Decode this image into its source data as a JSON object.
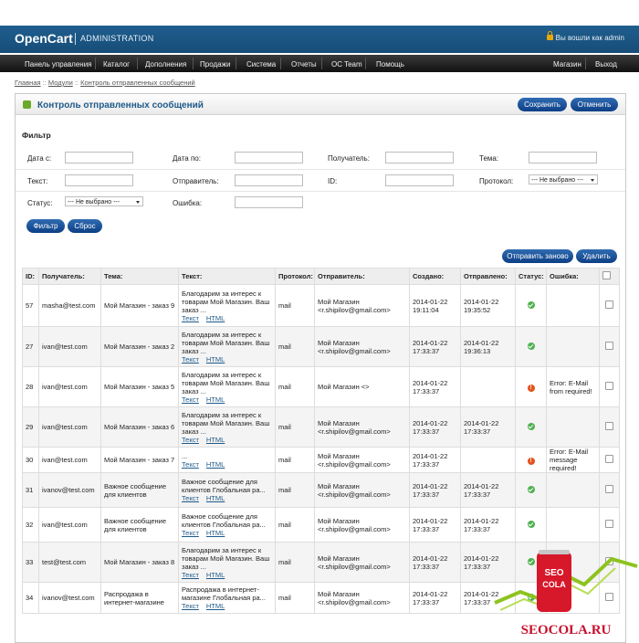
{
  "header": {
    "logo": "OpenCart",
    "subtitle": "ADMINISTRATION",
    "login_text": "Вы вошли как admin"
  },
  "menu": {
    "left": [
      "Панель управления",
      "Каталог",
      "Дополнения",
      "Продажи",
      "Система",
      "Отчеты",
      "OC Team",
      "Помощь"
    ],
    "right": [
      "Магазин",
      "Выход"
    ]
  },
  "breadcrumb": [
    "Главная",
    "Модули",
    "Контроль отправленных сообщений"
  ],
  "box": {
    "title": "Контроль отправленных сообщений",
    "save": "Сохранить",
    "cancel": "Отменить"
  },
  "filter": {
    "title": "Фильтр",
    "date_from": "Дата с:",
    "date_to": "Дата по:",
    "recipient": "Получатель:",
    "subject": "Тема:",
    "text": "Текст:",
    "sender": "Отправитель:",
    "id": "ID:",
    "protocol": "Протокол:",
    "protocol_value": " --- Не выбрано --- ",
    "status": "Статус:",
    "status_value": " --- Не выбрано --- ",
    "error": "Ошибка:",
    "filter_btn": "Фильтр",
    "reset_btn": "Сброс"
  },
  "actions": {
    "resend": "Отправить заново",
    "delete": "Удалить"
  },
  "table": {
    "headers": [
      "ID:",
      "Получатель:",
      "Тема:",
      "Текст:",
      "Протокол:",
      "Отправитель:",
      "Создано:",
      "Отправлено:",
      "Статус:",
      "Ошибка:"
    ],
    "link_text": "Текст",
    "link_html": "HTML",
    "rows": [
      {
        "id": "57",
        "to": "masha@test.com",
        "subject": "Мой Магазин - заказ 9",
        "text": "Благодарим за интерес к товарам Мой Магазин. Ваш заказ ...",
        "protocol": "mail",
        "sender": "Мой Магазин <r.shipilov@gmail.com>",
        "created": "2014-01-22 19:11:04",
        "sent": "2014-01-22 19:35:52",
        "status": "ok",
        "error": ""
      },
      {
        "id": "27",
        "to": "ivan@test.com",
        "subject": "Мой Магазин - заказ 2",
        "text": "Благодарим за интерес к товарам Мой Магазин. Ваш заказ ...",
        "protocol": "mail",
        "sender": "Мой Магазин <r.shipilov@gmail.com>",
        "created": "2014-01-22 17:33:37",
        "sent": "2014-01-22 19:36:13",
        "status": "ok",
        "error": ""
      },
      {
        "id": "28",
        "to": "ivan@test.com",
        "subject": "Мой Магазин - заказ 5",
        "text": "Благодарим за интерес к товарам Мой Магазин. Ваш заказ ...",
        "protocol": "mail",
        "sender": "Мой Магазин <>",
        "created": "2014-01-22 17:33:37",
        "sent": "",
        "status": "error",
        "error": "Error: E-Mail from required!"
      },
      {
        "id": "29",
        "to": "ivan@test.com",
        "subject": "Мой Магазин - заказ 6",
        "text": "Благодарим за интерес к товарам Мой Магазин. Ваш заказ ...",
        "protocol": "mail",
        "sender": "Мой Магазин <r.shipilov@gmail.com>",
        "created": "2014-01-22 17:33:37",
        "sent": "2014-01-22 17:33:37",
        "status": "ok",
        "error": ""
      },
      {
        "id": "30",
        "to": "ivan@test.com",
        "subject": "Мой Магазин - заказ 7",
        "text": "...",
        "protocol": "mail",
        "sender": "Мой Магазин <r.shipilov@gmail.com>",
        "created": "2014-01-22 17:33:37",
        "sent": "",
        "status": "error",
        "error": "Error: E-Mail message required!"
      },
      {
        "id": "31",
        "to": "ivanov@test.com",
        "subject": "Важное сообщение для клиентов",
        "text": "Важное сообщение для клиентов Глобальная ра...",
        "protocol": "mail",
        "sender": "Мой Магазин <r.shipilov@gmail.com>",
        "created": "2014-01-22 17:33:37",
        "sent": "2014-01-22 17:33:37",
        "status": "ok",
        "error": ""
      },
      {
        "id": "32",
        "to": "ivan@test.com",
        "subject": "Важное сообщение для клиентов",
        "text": "Важное сообщение для клиентов Глобальная ра...",
        "protocol": "mail",
        "sender": "Мой Магазин <r.shipilov@gmail.com>",
        "created": "2014-01-22 17:33:37",
        "sent": "2014-01-22 17:33:37",
        "status": "ok",
        "error": ""
      },
      {
        "id": "33",
        "to": "test@test.com",
        "subject": "Мой Магазин - заказ 8",
        "text": "Благодарим за интерес к товарам Мой Магазин. Ваш заказ ...",
        "protocol": "mail",
        "sender": "Мой Магазин <r.shipilov@gmail.com>",
        "created": "2014-01-22 17:33:37",
        "sent": "2014-01-22 17:33:37",
        "status": "ok",
        "error": ""
      },
      {
        "id": "34",
        "to": "ivanov@test.com",
        "subject": "Распродажа в интернет-магазине",
        "text": "Распродажа в интернет-магазине Глобальная ра...",
        "protocol": "mail",
        "sender": "Мой Магазин <r.shipilov@gmail.com>",
        "created": "2014-01-22 17:33:37",
        "sent": "2014-01-22 17:33:37",
        "status": "ok",
        "error": ""
      }
    ]
  },
  "watermark": {
    "can_text": "SEO COLA",
    "site": "SEOCOLA.RU"
  }
}
